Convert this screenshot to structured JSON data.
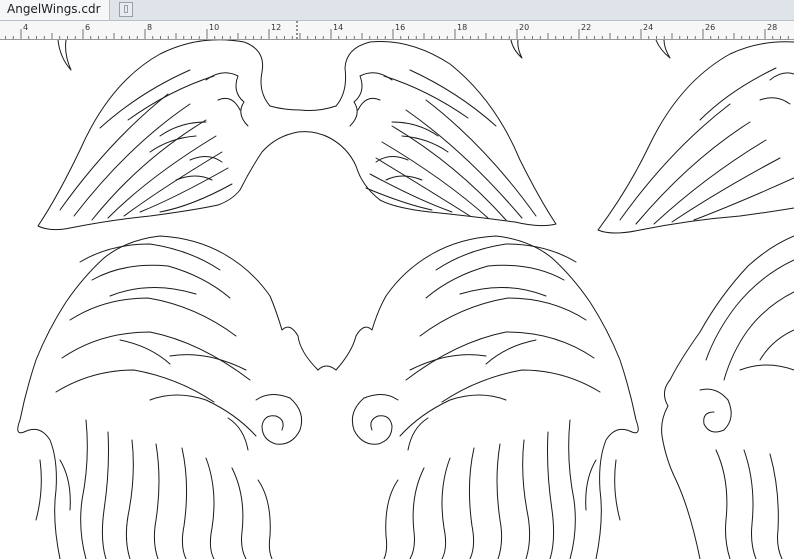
{
  "document_tab": {
    "title": "AngelWings.cdr"
  },
  "new_tab_icon": "new-tab-icon",
  "ruler": {
    "labels": [
      "4",
      "6",
      "8",
      "10",
      "12",
      "14",
      "16",
      "18",
      "20",
      "22",
      "24",
      "26",
      "28"
    ],
    "cursor_marker": "dashed"
  },
  "colors": {
    "tab_bar": "#dfe3ea",
    "active_tab": "#f6f7f9",
    "ruler_bg": "#f7f7f7",
    "canvas": "#ffffff",
    "outline": "#1a1a1a"
  }
}
